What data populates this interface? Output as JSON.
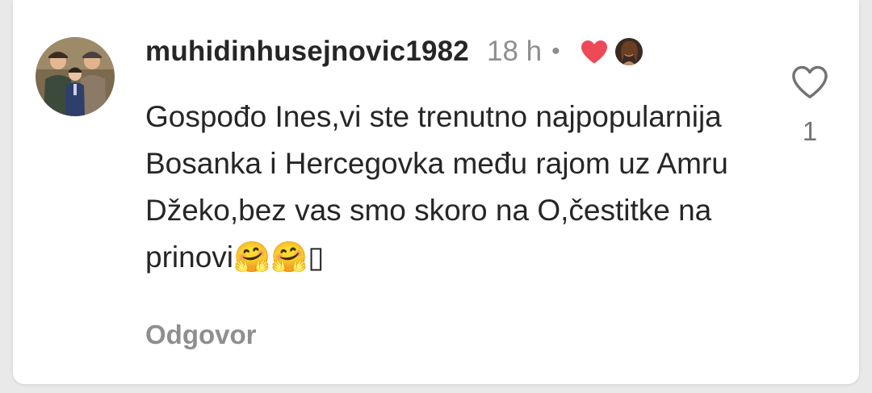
{
  "comment": {
    "username": "muhidinhusejnovic1982",
    "time": "18 h",
    "separator": "•",
    "text": "Gospođo Ines,vi ste trenutno najpopularnija Bosanka i Hercegovka među rajom uz Amru Džeko,bez vas smo skoro na O,čestitke na prinovi🤗🤗",
    "trailing_glyph": "▯",
    "reply_label": "Odgovor",
    "like_count": "1",
    "liked_by_author": true
  },
  "icons": {
    "author_like": "heart-filled-icon",
    "like_button": "heart-outline-icon"
  },
  "colors": {
    "heart": "#ed4956",
    "text": "#262626",
    "secondary": "#8e8e8e"
  }
}
